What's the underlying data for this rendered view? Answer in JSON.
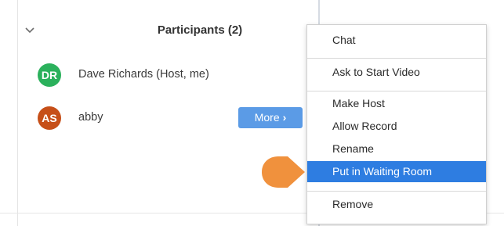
{
  "panel": {
    "title": "Participants (2)",
    "collapse_icon": "chevron-down-icon"
  },
  "participants": [
    {
      "initials": "DR",
      "name": "Dave Richards (Host, me)",
      "avatar_color": "#2bb15c"
    },
    {
      "initials": "AS",
      "name": "abby",
      "avatar_color": "#c64f18"
    }
  ],
  "more_button": {
    "label": "More",
    "icon": "chevron-right-icon",
    "color": "#5b9be6"
  },
  "context_menu": {
    "items": [
      {
        "label": "Chat"
      },
      {
        "label": "Ask to Start Video"
      },
      {
        "label": "Make Host"
      },
      {
        "label": "Allow Record"
      },
      {
        "label": "Rename"
      },
      {
        "label": "Put in Waiting Room",
        "selected": true
      },
      {
        "label": "Remove"
      }
    ],
    "selected_color": "#2e7de1"
  },
  "pointer": {
    "icon": "pointer-arrow-icon",
    "color": "#f0913d"
  }
}
